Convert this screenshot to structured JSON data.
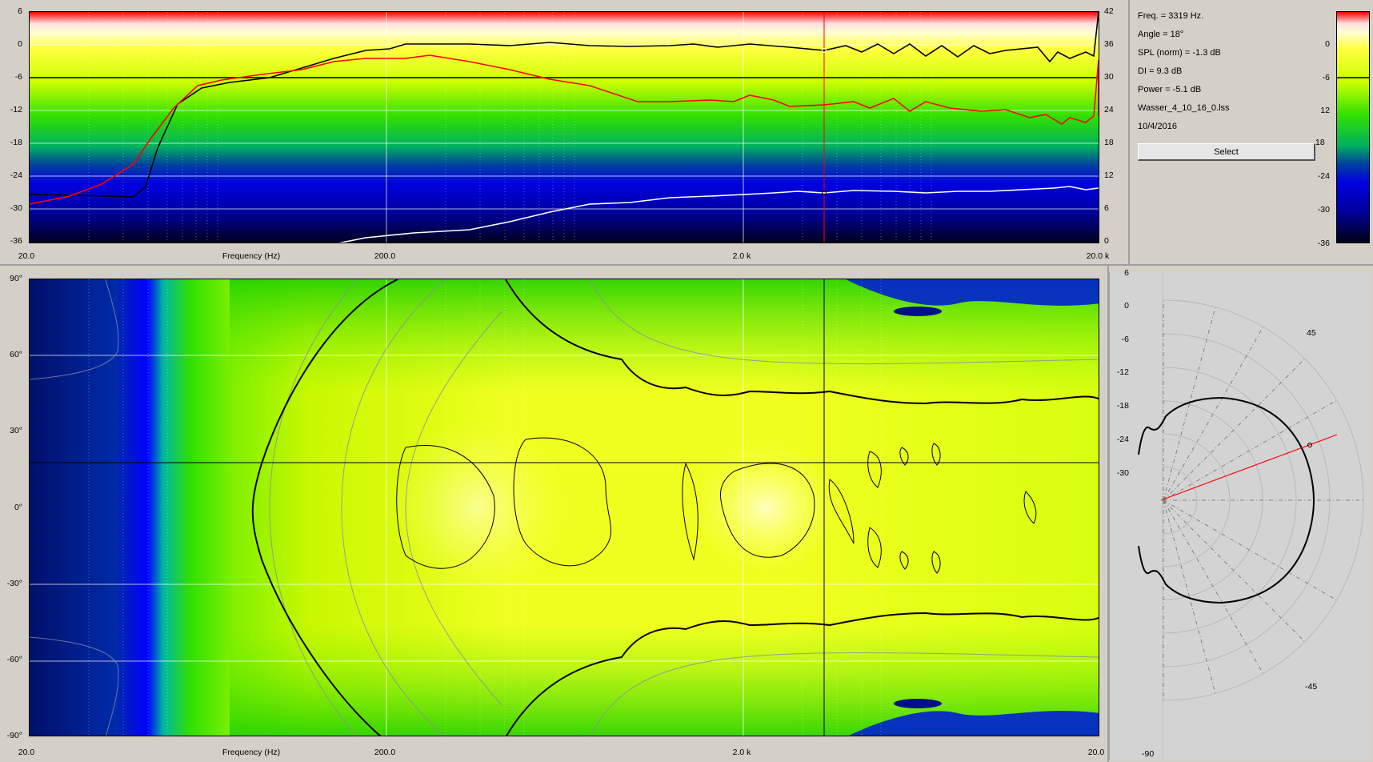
{
  "top_chart": {
    "y_left_ticks": [
      "6",
      "0",
      "-6",
      "-12",
      "-18",
      "-24",
      "-30",
      "-36"
    ],
    "y_right_ticks": [
      "42",
      "36",
      "30",
      "24",
      "18",
      "12",
      "6",
      "0"
    ],
    "x_ticks": [
      "20.0",
      "200.0",
      "2.0 k",
      "20.0 k"
    ],
    "x_label": "Frequency (Hz)"
  },
  "bottom_chart": {
    "y_ticks": [
      "90°",
      "60°",
      "30°",
      "0°",
      "-30°",
      "-60°",
      "-90°"
    ],
    "x_ticks": [
      "20.0",
      "200.0",
      "2.0 k",
      "20.0"
    ],
    "x_label": "Frequency (Hz)"
  },
  "info": {
    "freq": "Freq. = 3319 Hz.",
    "angle": "Angle = 18°",
    "spl": "SPL (norm) = -1.3 dB",
    "di": "DI = 9.3 dB",
    "power": "Power = -5.1 dB",
    "file": "Wasser_4_10_16_0.lss",
    "date": "10/4/2016",
    "select_label": "Select"
  },
  "colorbar": {
    "left_ticks": [
      "0",
      "-6",
      "12",
      "18",
      "-24",
      "-30",
      "-36"
    ],
    "right_ticks": [
      "18"
    ]
  },
  "polar": {
    "radial_ticks": [
      "6",
      "0",
      "-6",
      "-12",
      "-18",
      "-24",
      "-30"
    ],
    "angle_labels": [
      "45",
      "-45",
      "-90"
    ]
  },
  "colors": {
    "spl_curve": "#000000",
    "power_curve": "#ff0000",
    "di_curve": "#ffffff",
    "cursor": "#ff0000",
    "panel_bg": "#d4d0c8"
  }
}
